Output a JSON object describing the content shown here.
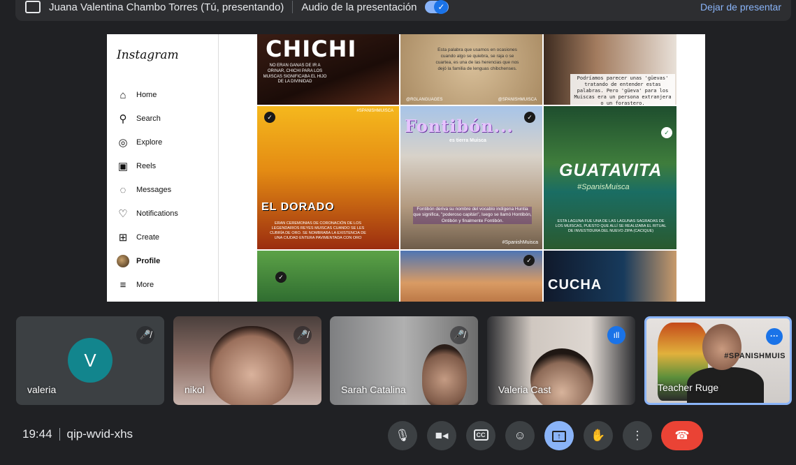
{
  "presenting_bar": {
    "presenter_text": "Juana Valentina Chambo Torres (Tú, presentando)",
    "audio_label": "Audio de la presentación",
    "stop_label": "Dejar de presentar"
  },
  "instagram": {
    "logo": "Instagram",
    "nav": [
      {
        "label": "Home",
        "icon": "home-icon"
      },
      {
        "label": "Search",
        "icon": "search-icon"
      },
      {
        "label": "Explore",
        "icon": "compass-icon"
      },
      {
        "label": "Reels",
        "icon": "reels-icon"
      },
      {
        "label": "Messages",
        "icon": "messenger-icon"
      },
      {
        "label": "Notifications",
        "icon": "heart-icon"
      },
      {
        "label": "Create",
        "icon": "plus-icon"
      },
      {
        "label": "Profile",
        "icon": "profile-avatar"
      },
      {
        "label": "More",
        "icon": "menu-icon"
      }
    ],
    "posts": {
      "chichi_title": "CHICHI",
      "chichi_text": "NO ERAN GANAS DE IR A ORINAR, CHICHI PARA LOS MUISCAS SIGNIFICABA EL HIJO DE LA DIVINIDAD",
      "quote_text": "Esta palabra que usamos en ocasiones cuando algo se quiebra, se raja o se cuartea, es una de las herencias que nos dejó la familia de lenguas chibchenses.",
      "quote_tag_left": "@RGLANGUAGES",
      "quote_tag_right": "@SPANISHMUISCA",
      "guevas_text": "Podríamos parecer unas 'güevas' tratando de entender estas palabras. Pero 'güeva' para los Muiscas era un persona extranjera o un forastero.",
      "dorado_title": "EL DORADO",
      "dorado_tag": "#SPANISHMUISCA",
      "dorado_text": "ERAN CEREMONIAS DE CORONACIÓN DE LOS LEGENDARIOS REYES MUISCAS CUANDO SE LES CUBRÍA DE ORO. SE NOMBRABA LA EXISTENCIA DE UNA CIUDAD ENTERA PAVIMENTADA CON ORO",
      "fontibon_title": "Fontibón...",
      "fontibon_sub": "es tierra Muisca",
      "fontibon_text": "Fontibón deriva su nombre del vocablo indígena Huntia que significa, \"poderoso capitán\", luego se llamó Hontibón, Ontibón y finalmente Fontibón.",
      "fontibon_tag": "#SpanishMuisca",
      "guatavita_title": "GUATAVITA",
      "guatavita_script": "#SpanisMuisca",
      "guatavita_text": "ESTA LAGUNA FUE UNA DE LAS LAGUNAS SAGRADAS DE LOS MUISCAS, PUESTO QUE ALLÍ SE REALIZABA EL RITUAL DE INVESTIDURA DEL NUEVO ZIPA (CACIQUE)",
      "cucha_title": "CUCHA"
    }
  },
  "participants": [
    {
      "name": "valeria",
      "initial": "V",
      "muted": true
    },
    {
      "name": "nikol",
      "muted": true
    },
    {
      "name": "Sarah Catalina",
      "muted": true
    },
    {
      "name": "Valeria Cast",
      "muted": false
    },
    {
      "name": "Teacher Ruge",
      "muted": false,
      "wall_text": "#SPANISHMUIS"
    }
  ],
  "meeting": {
    "time": "19:44",
    "code": "qip-wvid-xhs"
  },
  "controls": {
    "cc_label": "CC",
    "present_glyph": "↑"
  },
  "colors": {
    "accent": "#8ab4f8",
    "hangup": "#ea4335",
    "avatar": "#12858d"
  }
}
